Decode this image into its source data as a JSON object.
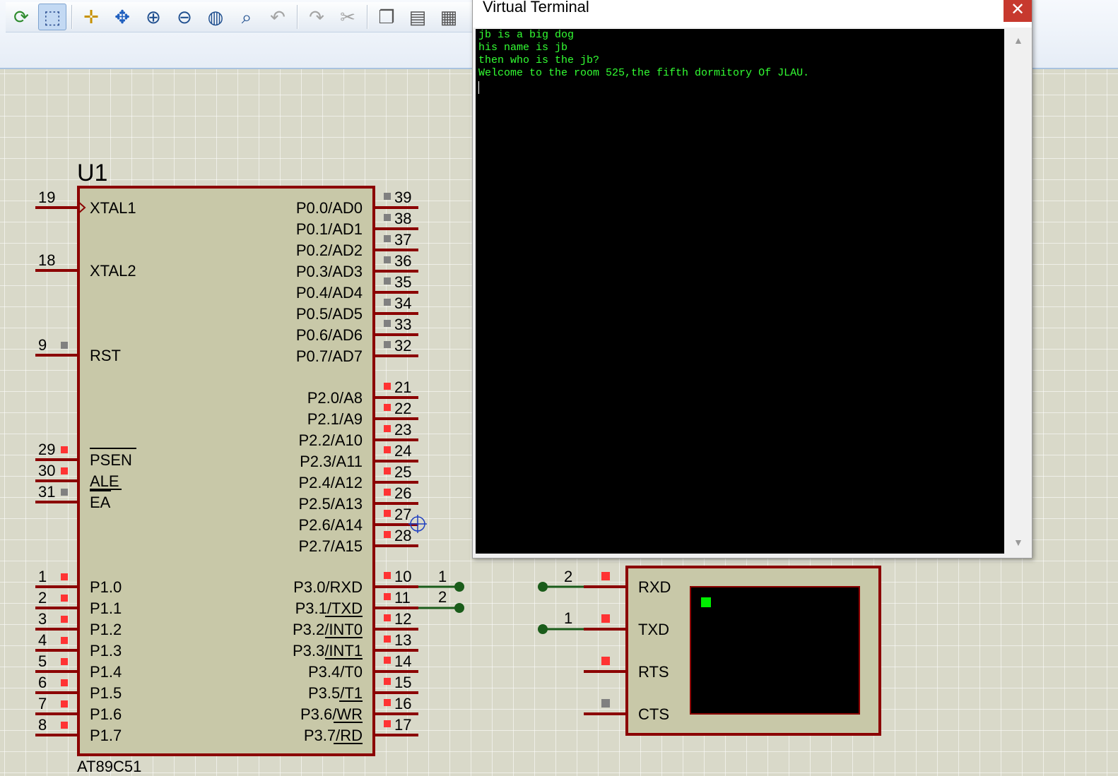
{
  "toolbar": {
    "buttons": [
      {
        "name": "refresh-icon",
        "glyph": "⟳",
        "color": "#2e8b2e"
      },
      {
        "name": "area-select-icon",
        "glyph": "⬚",
        "color": "#2a4d8f",
        "active": true
      },
      {
        "name": "origin-crosshair-icon",
        "glyph": "✛",
        "color": "#c79100"
      },
      {
        "name": "pan-icon",
        "glyph": "✥",
        "color": "#1f5fbf"
      },
      {
        "name": "zoom-in-icon",
        "glyph": "⊕",
        "color": "#1f4f8f"
      },
      {
        "name": "zoom-out-icon",
        "glyph": "⊖",
        "color": "#1f4f8f"
      },
      {
        "name": "zoom-all-icon",
        "glyph": "◍",
        "color": "#1f4f8f"
      },
      {
        "name": "zoom-area-icon",
        "glyph": "⌕",
        "color": "#1f4f8f"
      },
      {
        "name": "undo-icon",
        "glyph": "↶",
        "color": "#a4a4a4",
        "disabled": true
      },
      {
        "name": "redo-icon",
        "glyph": "↷",
        "color": "#a4a4a4",
        "disabled": true
      },
      {
        "name": "cut-icon",
        "glyph": "✂",
        "color": "#a4a4a4",
        "disabled": true
      },
      {
        "name": "copy-icon",
        "glyph": "❐",
        "color": "#555555"
      },
      {
        "name": "paste-icon",
        "glyph": "▤",
        "color": "#555555"
      },
      {
        "name": "block-copy-icon",
        "glyph": "▦",
        "color": "#555555"
      }
    ]
  },
  "schematic": {
    "component_ref": "U1",
    "component_type": "AT89C51",
    "left_pins": [
      {
        "num": "19",
        "label": "XTAL1"
      },
      {
        "num": "18",
        "label": "XTAL2"
      },
      {
        "num": "9",
        "label": "RST"
      },
      {
        "num": "29",
        "label": "PSEN"
      },
      {
        "num": "30",
        "label": "ALE"
      },
      {
        "num": "31",
        "label": "EA"
      },
      {
        "num": "1",
        "label": "P1.0"
      },
      {
        "num": "2",
        "label": "P1.1"
      },
      {
        "num": "3",
        "label": "P1.2"
      },
      {
        "num": "4",
        "label": "P1.3"
      },
      {
        "num": "5",
        "label": "P1.4"
      },
      {
        "num": "6",
        "label": "P1.5"
      },
      {
        "num": "7",
        "label": "P1.6"
      },
      {
        "num": "8",
        "label": "P1.7"
      }
    ],
    "right_pins": [
      {
        "num": "39",
        "label": "P0.0/AD0"
      },
      {
        "num": "38",
        "label": "P0.1/AD1"
      },
      {
        "num": "37",
        "label": "P0.2/AD2"
      },
      {
        "num": "36",
        "label": "P0.3/AD3"
      },
      {
        "num": "35",
        "label": "P0.4/AD4"
      },
      {
        "num": "34",
        "label": "P0.5/AD5"
      },
      {
        "num": "33",
        "label": "P0.6/AD6"
      },
      {
        "num": "32",
        "label": "P0.7/AD7"
      },
      {
        "num": "21",
        "label": "P2.0/A8"
      },
      {
        "num": "22",
        "label": "P2.1/A9"
      },
      {
        "num": "23",
        "label": "P2.2/A10"
      },
      {
        "num": "24",
        "label": "P2.3/A11"
      },
      {
        "num": "25",
        "label": "P2.4/A12"
      },
      {
        "num": "26",
        "label": "P2.5/A13"
      },
      {
        "num": "27",
        "label": "P2.6/A14"
      },
      {
        "num": "28",
        "label": "P2.7/A15"
      },
      {
        "num": "10",
        "label": "P3.0/RXD"
      },
      {
        "num": "11",
        "label": "P3.1/TXD"
      },
      {
        "num": "12",
        "label": "P3.2/INT0"
      },
      {
        "num": "13",
        "label": "P3.3/INT1"
      },
      {
        "num": "14",
        "label": "P3.4/T0"
      },
      {
        "num": "15",
        "label": "P3.5/T1"
      },
      {
        "num": "16",
        "label": "P3.6/WR"
      },
      {
        "num": "17",
        "label": "P3.7/RD"
      }
    ],
    "net_labels": {
      "rxd_out": "1",
      "txd_out": "2",
      "term_rxd": "2",
      "term_txd": "1"
    },
    "terminal_pins": [
      "RXD",
      "TXD",
      "RTS",
      "CTS"
    ],
    "colors": {
      "wire": "#8b0000",
      "body": "#c8c8a8",
      "pin_active": "#ff3333",
      "pin_idle": "#808080",
      "net": "#1a5c1a"
    }
  },
  "virtual_terminal": {
    "title": "Virtual Terminal",
    "close_glyph": "✕",
    "lines": [
      "jb is a big dog",
      "his name is jb",
      "then who is the jb?",
      "Welcome to the room 525,the fifth dormitory Of JLAU."
    ],
    "scroll_up_glyph": "▲",
    "scroll_down_glyph": "▼"
  }
}
